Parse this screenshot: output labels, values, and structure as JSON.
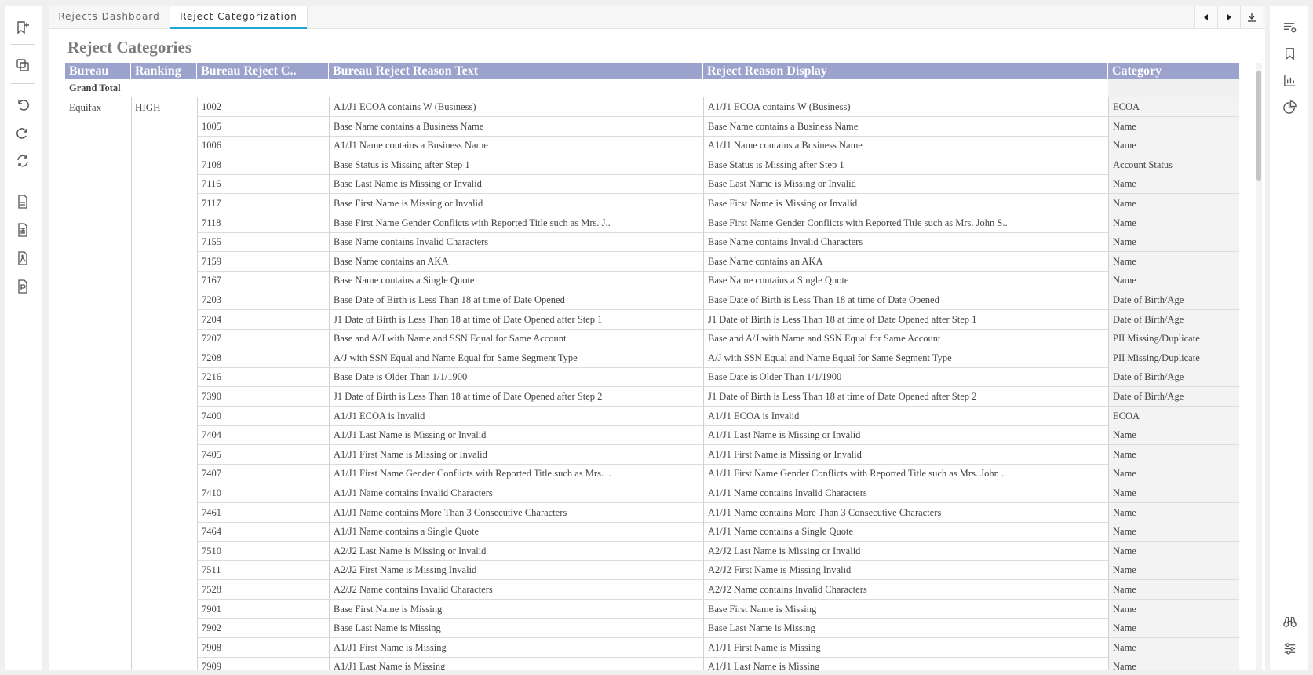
{
  "tabs": [
    {
      "label": "Rejects Dashboard",
      "active": false
    },
    {
      "label": "Reject Categorization",
      "active": true
    }
  ],
  "report": {
    "title": "Reject Categories",
    "columns": [
      "Bureau",
      "Ranking",
      "Bureau Reject C..",
      "Bureau Reject Reason Text",
      "Reject Reason Display",
      "Category"
    ],
    "grand_total_label": "Grand Total",
    "bureau": "Equifax",
    "ranking": "HIGH",
    "rows": [
      {
        "code": "1002",
        "reason": "A1/J1 ECOA contains W (Business)",
        "display": "A1/J1 ECOA contains W (Business)",
        "category": "ECOA"
      },
      {
        "code": "1005",
        "reason": "Base Name contains a Business Name",
        "display": "Base Name contains a Business Name",
        "category": "Name"
      },
      {
        "code": "1006",
        "reason": "A1/J1 Name contains a Business Name",
        "display": "A1/J1 Name contains a Business Name",
        "category": "Name"
      },
      {
        "code": "7108",
        "reason": "Base Status is Missing after Step 1",
        "display": "Base Status is Missing after Step 1",
        "category": "Account Status"
      },
      {
        "code": "7116",
        "reason": "Base Last Name is Missing or Invalid",
        "display": "Base Last Name is Missing or Invalid",
        "category": "Name"
      },
      {
        "code": "7117",
        "reason": "Base First Name is Missing or Invalid",
        "display": "Base First Name is Missing or Invalid",
        "category": "Name"
      },
      {
        "code": "7118",
        "reason": "Base First Name Gender Conflicts with Reported Title such as Mrs. J..",
        "display": "Base First Name Gender Conflicts with Reported Title such as Mrs. John S..",
        "category": "Name"
      },
      {
        "code": "7155",
        "reason": "Base Name contains Invalid Characters",
        "display": "Base Name contains Invalid Characters",
        "category": "Name"
      },
      {
        "code": "7159",
        "reason": "Base Name contains an AKA",
        "display": "Base Name contains an AKA",
        "category": "Name"
      },
      {
        "code": "7167",
        "reason": "Base Name contains a Single Quote",
        "display": "Base Name contains a Single Quote",
        "category": "Name"
      },
      {
        "code": "7203",
        "reason": "Base Date of Birth is Less Than 18 at time of Date Opened",
        "display": "Base Date of Birth is Less Than 18 at time of Date Opened",
        "category": "Date of Birth/Age"
      },
      {
        "code": "7204",
        "reason": "J1 Date of Birth is Less Than 18 at time of Date Opened after Step 1",
        "display": "J1 Date of Birth is Less Than 18 at time of Date Opened after Step 1",
        "category": "Date of Birth/Age"
      },
      {
        "code": "7207",
        "reason": "Base and A/J with Name and SSN Equal for Same Account",
        "display": "Base and A/J with Name and SSN Equal for Same Account",
        "category": "PII Missing/Duplicate"
      },
      {
        "code": "7208",
        "reason": "A/J with SSN Equal and Name Equal for Same Segment Type",
        "display": "A/J with SSN Equal and Name Equal for Same Segment Type",
        "category": "PII Missing/Duplicate"
      },
      {
        "code": "7216",
        "reason": "Base Date is Older Than 1/1/1900",
        "display": "Base Date is Older Than 1/1/1900",
        "category": "Date of Birth/Age"
      },
      {
        "code": "7390",
        "reason": "J1 Date of Birth is Less Than 18 at time of Date Opened after Step 2",
        "display": "J1 Date of Birth is Less Than 18 at time of Date Opened after Step 2",
        "category": "Date of Birth/Age"
      },
      {
        "code": "7400",
        "reason": "A1/J1 ECOA is Invalid",
        "display": "A1/J1 ECOA is Invalid",
        "category": "ECOA"
      },
      {
        "code": "7404",
        "reason": "A1/J1 Last Name is Missing or Invalid",
        "display": "A1/J1 Last Name is Missing or Invalid",
        "category": "Name"
      },
      {
        "code": "7405",
        "reason": "A1/J1 First Name is Missing or Invalid",
        "display": "A1/J1 First Name is Missing or Invalid",
        "category": "Name"
      },
      {
        "code": "7407",
        "reason": "A1/J1 First Name Gender Conflicts with Reported Title such as Mrs. ..",
        "display": "A1/J1 First Name Gender Conflicts with Reported Title such as Mrs. John ..",
        "category": "Name"
      },
      {
        "code": "7410",
        "reason": "A1/J1 Name contains Invalid Characters",
        "display": "A1/J1 Name contains Invalid Characters",
        "category": "Name"
      },
      {
        "code": "7461",
        "reason": "A1/J1 Name contains More Than 3 Consecutive Characters",
        "display": "A1/J1 Name contains More Than 3 Consecutive Characters",
        "category": "Name"
      },
      {
        "code": "7464",
        "reason": "A1/J1 Name contains a Single Quote",
        "display": "A1/J1 Name contains a Single Quote",
        "category": "Name"
      },
      {
        "code": "7510",
        "reason": "A2/J2 Last Name is Missing or Invalid",
        "display": "A2/J2 Last Name is Missing or Invalid",
        "category": "Name"
      },
      {
        "code": "7511",
        "reason": "A2/J2 First Name is Missing Invalid",
        "display": "A2/J2 First Name is Missing Invalid",
        "category": "Name"
      },
      {
        "code": "7528",
        "reason": "A2/J2 Name contains Invalid Characters",
        "display": "A2/J2 Name contains Invalid Characters",
        "category": "Name"
      },
      {
        "code": "7901",
        "reason": "Base First Name is Missing",
        "display": "Base First Name is Missing",
        "category": "Name"
      },
      {
        "code": "7902",
        "reason": "Base Last Name is Missing",
        "display": "Base Last Name is Missing",
        "category": "Name"
      },
      {
        "code": "7908",
        "reason": "A1/J1 First Name is Missing",
        "display": "A1/J1 First Name is Missing",
        "category": "Name"
      },
      {
        "code": "7909",
        "reason": "A1/J1 Last Name is Missing",
        "display": "A1/J1 Last Name is Missing",
        "category": "Name"
      }
    ]
  },
  "left_toolbar": [
    "add-bookmark-icon",
    "duplicate-icon",
    "undo-icon",
    "redo-icon",
    "refresh-icon",
    "export-csv-icon",
    "export-excel-icon",
    "export-pdf-icon",
    "export-ppt-icon"
  ],
  "right_toolbar": [
    "filter-settings-icon",
    "bookmark-icon",
    "bar-chart-icon",
    "pie-chart-icon",
    "binoculars-icon",
    "sliders-icon"
  ],
  "colors": {
    "header": "#9ba2cc",
    "tab_accent": "#1fa6d6",
    "title": "#7b7b7b",
    "text": "#444444"
  }
}
